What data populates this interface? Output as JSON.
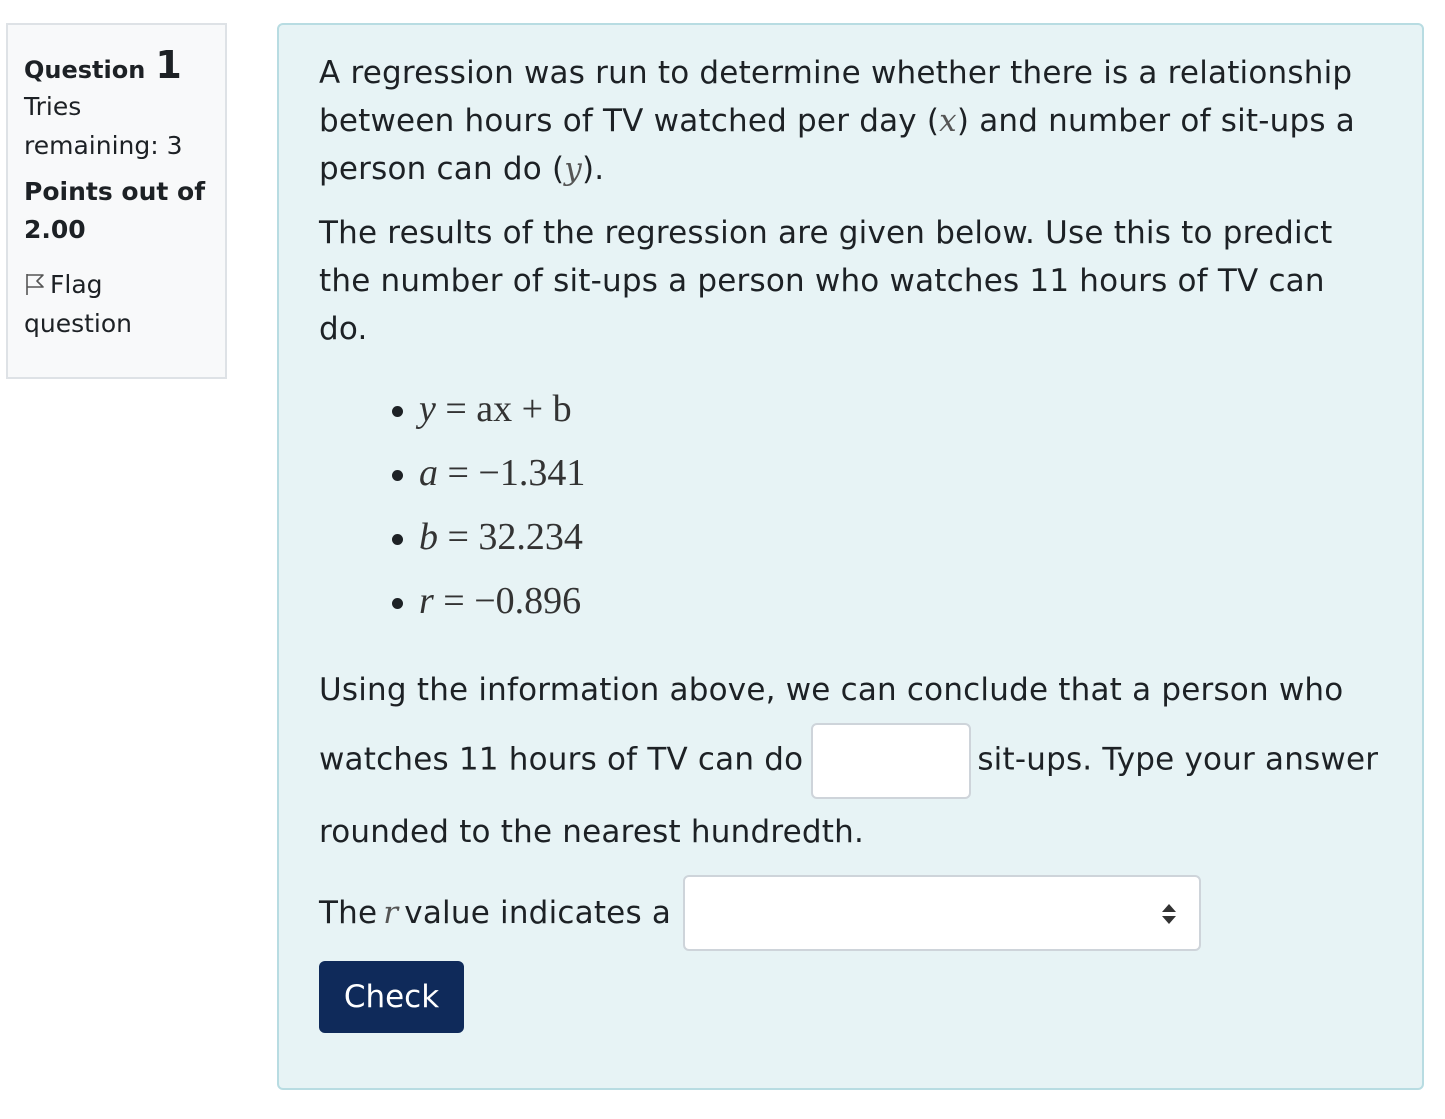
{
  "info": {
    "question_word": "Question",
    "question_number": "1",
    "tries_label": "Tries remaining: 3",
    "points_label": "Points out of 2.00",
    "flag_label": "Flag question"
  },
  "question": {
    "intro_part1": "A regression was run to determine whether there is a relationship between hours of TV watched per day (",
    "intro_var_x": "x",
    "intro_part2": ") and number of sit-ups a person can do (",
    "intro_var_y": "y",
    "intro_part3": ").",
    "results_text": "The results of the regression are given below. Use this to predict the number of sit-ups a person who watches 11 hours of TV can do.",
    "equations": [
      {
        "lhs": "y",
        "rhs": "= ax + b"
      },
      {
        "lhs": "a",
        "rhs": "= −1.341"
      },
      {
        "lhs": "b",
        "rhs": "= 32.234"
      },
      {
        "lhs": "r",
        "rhs": "= −0.896"
      }
    ],
    "answer_part1": "Using the information above, we can conclude that a person who watches 11 hours of TV can do",
    "answer_value": "",
    "answer_part2": "sit-ups. Type your answer rounded to the nearest hundredth.",
    "r_part1": "The",
    "r_var": "r",
    "r_part2": "value indicates a",
    "r_select_value": ""
  },
  "buttons": {
    "check_label": "Check"
  }
}
